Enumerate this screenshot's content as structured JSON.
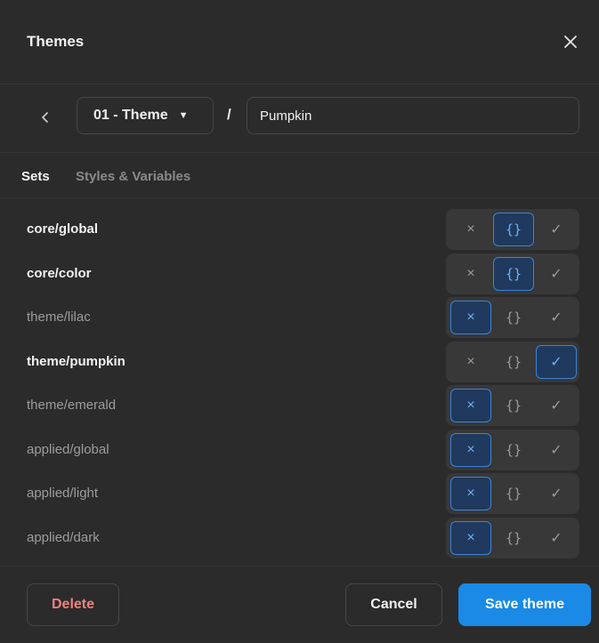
{
  "modal": {
    "title": "Themes",
    "close_icon": "close-icon"
  },
  "toolbar": {
    "back_icon": "chevron-left-icon",
    "theme_group": "01 - Theme",
    "separator": "/",
    "theme_name": "Pumpkin"
  },
  "tabs": [
    {
      "label": "Sets",
      "active": true
    },
    {
      "label": "Styles & Variables",
      "active": false
    }
  ],
  "state_options": {
    "disabled": "×",
    "source": "{}",
    "enabled": "✓"
  },
  "sets": [
    {
      "name": "core/global",
      "state": "source"
    },
    {
      "name": "core/color",
      "state": "source"
    },
    {
      "name": "theme/lilac",
      "state": "disabled"
    },
    {
      "name": "theme/pumpkin",
      "state": "enabled"
    },
    {
      "name": "theme/emerald",
      "state": "disabled"
    },
    {
      "name": "applied/global",
      "state": "disabled"
    },
    {
      "name": "applied/light",
      "state": "disabled"
    },
    {
      "name": "applied/dark",
      "state": "disabled"
    }
  ],
  "footer": {
    "delete": "Delete",
    "cancel": "Cancel",
    "save": "Save theme"
  },
  "colors": {
    "accent": "#1a8ae6",
    "selected_border": "#3c83d8",
    "danger": "#f08080"
  }
}
